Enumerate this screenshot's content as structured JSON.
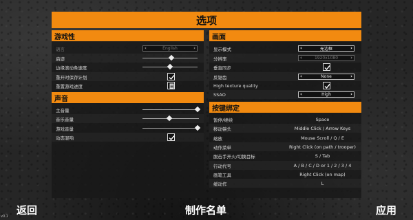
{
  "title": "选项",
  "gameplay": {
    "header": "游戏性",
    "language": {
      "label": "语言",
      "value": "English"
    },
    "pause_label": "启迹",
    "edge_scroll_label": "边缘滚动条速度",
    "restart_plan_label": "重开时保存计划",
    "reset_progress_label": "重置游戏进度"
  },
  "sound": {
    "header": "声音",
    "master_label": "主音量",
    "music_label": "音乐音量",
    "game_label": "游戏音量",
    "dynamic_subtitles_label": "动态混响"
  },
  "graphics": {
    "header": "画面",
    "display_mode": {
      "label": "显示模式",
      "value": "无边框"
    },
    "resolution": {
      "label": "分辨率",
      "value": "1920x1080"
    },
    "vsync_label": "垂直同步",
    "antialias": {
      "label": "反锯齿",
      "value": "None"
    },
    "texture_label": "High texture quality",
    "ssao": {
      "label": "SSAO",
      "value": "High"
    }
  },
  "keybindings": {
    "header": "按键绑定",
    "rows": [
      {
        "label": "暂停/继续",
        "key": "Space"
      },
      {
        "label": "移动镜头",
        "key": "Middle Click / Arrow Keys"
      },
      {
        "label": "缩放",
        "key": "Mouse Scroll / Q / E"
      },
      {
        "label": "动作菜单",
        "key": "Right Click (on path / trooper)"
      },
      {
        "label": "脱击手开火/切换目标",
        "key": "S / Tab"
      },
      {
        "label": "行动代号",
        "key": "A / B / C / D or 1 / 2 / 3 / 4"
      },
      {
        "label": "画笔工具",
        "key": "Right Click (on map)"
      },
      {
        "label": "缓动作",
        "key": "L"
      }
    ]
  },
  "footer": {
    "back": "返回",
    "credits": "制作名单",
    "apply": "应用",
    "version": "v0.1"
  },
  "slider_values": {
    "edge_scroll": 0.5,
    "master": 0.98,
    "music": 0.48,
    "game": 0.98
  },
  "colors": {
    "accent": "#f28a10"
  }
}
